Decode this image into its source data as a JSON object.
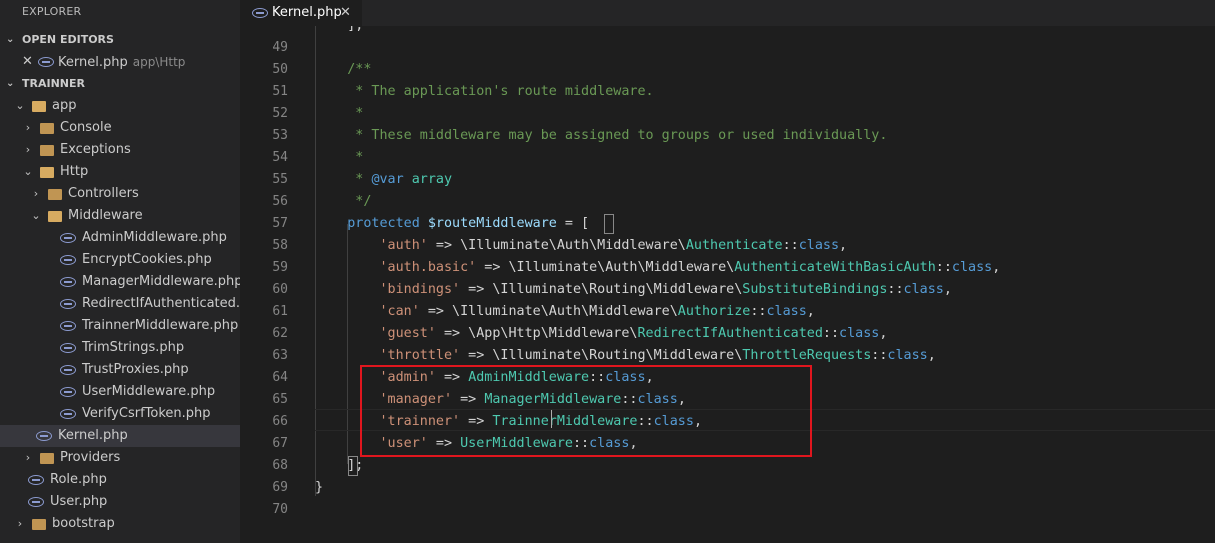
{
  "sidebar": {
    "title": "EXPLORER",
    "open_editors_label": "OPEN EDITORS",
    "open_editor": {
      "name": "Kernel.php",
      "path": "app\\Http"
    },
    "project_label": "TRAINNER",
    "tree": [
      {
        "label": "app",
        "depth": 0,
        "type": "folder-open",
        "chev": "⌄"
      },
      {
        "label": "Console",
        "depth": 1,
        "type": "folder",
        "chev": "›"
      },
      {
        "label": "Exceptions",
        "depth": 1,
        "type": "folder",
        "chev": "›"
      },
      {
        "label": "Http",
        "depth": 1,
        "type": "folder-open",
        "chev": "⌄"
      },
      {
        "label": "Controllers",
        "depth": 2,
        "type": "folder",
        "chev": "›"
      },
      {
        "label": "Middleware",
        "depth": 2,
        "type": "folder-open",
        "chev": "⌄"
      },
      {
        "label": "AdminMiddleware.php",
        "depth": 3,
        "type": "php"
      },
      {
        "label": "EncryptCookies.php",
        "depth": 3,
        "type": "php"
      },
      {
        "label": "ManagerMiddleware.php",
        "depth": 3,
        "type": "php"
      },
      {
        "label": "RedirectIfAuthenticated.p...",
        "depth": 3,
        "type": "php"
      },
      {
        "label": "TrainnerMiddleware.php",
        "depth": 3,
        "type": "php"
      },
      {
        "label": "TrimStrings.php",
        "depth": 3,
        "type": "php"
      },
      {
        "label": "TrustProxies.php",
        "depth": 3,
        "type": "php"
      },
      {
        "label": "UserMiddleware.php",
        "depth": 3,
        "type": "php"
      },
      {
        "label": "VerifyCsrfToken.php",
        "depth": 3,
        "type": "php"
      },
      {
        "label": "Kernel.php",
        "depth": 2,
        "type": "php",
        "selected": true
      },
      {
        "label": "Providers",
        "depth": 1,
        "type": "folder",
        "chev": "›"
      },
      {
        "label": "Role.php",
        "depth": 1,
        "type": "php"
      },
      {
        "label": "User.php",
        "depth": 1,
        "type": "php"
      },
      {
        "label": "bootstrap",
        "depth": 0,
        "type": "folder",
        "chev": "›"
      }
    ]
  },
  "tab": {
    "label": "Kernel.php",
    "close": "✕"
  },
  "editor": {
    "lines": [
      {
        "n": "",
        "segs": [
          [
            "pl",
            "    ];"
          ]
        ]
      },
      {
        "n": "49",
        "segs": []
      },
      {
        "n": "50",
        "segs": [
          [
            "cm",
            "    /**"
          ]
        ]
      },
      {
        "n": "51",
        "segs": [
          [
            "cm",
            "     * The application's route middleware."
          ]
        ]
      },
      {
        "n": "52",
        "segs": [
          [
            "cm",
            "     *"
          ]
        ]
      },
      {
        "n": "53",
        "segs": [
          [
            "cm",
            "     * These middleware may be assigned to groups or used individually."
          ]
        ]
      },
      {
        "n": "54",
        "segs": [
          [
            "cm",
            "     *"
          ]
        ]
      },
      {
        "n": "55",
        "segs": [
          [
            "cm",
            "     * "
          ],
          [
            "kw",
            "@var"
          ],
          [
            "cm",
            " "
          ],
          [
            "cl",
            "array"
          ]
        ]
      },
      {
        "n": "56",
        "segs": [
          [
            "cm",
            "     */"
          ]
        ]
      },
      {
        "n": "57",
        "segs": [
          [
            "kw",
            "    protected "
          ],
          [
            "vr",
            "$routeMiddleware"
          ],
          [
            "pl",
            " = ["
          ]
        ]
      },
      {
        "n": "58",
        "segs": [
          [
            "st",
            "        'auth'"
          ],
          [
            "pl",
            " => \\Illuminate\\Auth\\Middleware\\"
          ],
          [
            "cl",
            "Authenticate"
          ],
          [
            "pl",
            "::"
          ],
          [
            "kw",
            "class"
          ],
          [
            "pl",
            ","
          ]
        ]
      },
      {
        "n": "59",
        "segs": [
          [
            "st",
            "        'auth.basic'"
          ],
          [
            "pl",
            " => \\Illuminate\\Auth\\Middleware\\"
          ],
          [
            "cl",
            "AuthenticateWithBasicAuth"
          ],
          [
            "pl",
            "::"
          ],
          [
            "kw",
            "class"
          ],
          [
            "pl",
            ","
          ]
        ]
      },
      {
        "n": "60",
        "segs": [
          [
            "st",
            "        'bindings'"
          ],
          [
            "pl",
            " => \\Illuminate\\Routing\\Middleware\\"
          ],
          [
            "cl",
            "SubstituteBindings"
          ],
          [
            "pl",
            "::"
          ],
          [
            "kw",
            "class"
          ],
          [
            "pl",
            ","
          ]
        ]
      },
      {
        "n": "61",
        "segs": [
          [
            "st",
            "        'can'"
          ],
          [
            "pl",
            " => \\Illuminate\\Auth\\Middleware\\"
          ],
          [
            "cl",
            "Authorize"
          ],
          [
            "pl",
            "::"
          ],
          [
            "kw",
            "class"
          ],
          [
            "pl",
            ","
          ]
        ]
      },
      {
        "n": "62",
        "segs": [
          [
            "st",
            "        'guest'"
          ],
          [
            "pl",
            " => \\App\\Http\\Middleware\\"
          ],
          [
            "cl",
            "RedirectIfAuthenticated"
          ],
          [
            "pl",
            "::"
          ],
          [
            "kw",
            "class"
          ],
          [
            "pl",
            ","
          ]
        ]
      },
      {
        "n": "63",
        "segs": [
          [
            "st",
            "        'throttle'"
          ],
          [
            "pl",
            " => \\Illuminate\\Routing\\Middleware\\"
          ],
          [
            "cl",
            "ThrottleRequests"
          ],
          [
            "pl",
            "::"
          ],
          [
            "kw",
            "class"
          ],
          [
            "pl",
            ","
          ]
        ]
      },
      {
        "n": "64",
        "segs": [
          [
            "st",
            "        'admin'"
          ],
          [
            "pl",
            " => "
          ],
          [
            "cl",
            "AdminMiddleware"
          ],
          [
            "pl",
            "::"
          ],
          [
            "kw",
            "class"
          ],
          [
            "pl",
            ","
          ]
        ]
      },
      {
        "n": "65",
        "segs": [
          [
            "st",
            "        'manager'"
          ],
          [
            "pl",
            " => "
          ],
          [
            "cl",
            "ManagerMiddleware"
          ],
          [
            "pl",
            "::"
          ],
          [
            "kw",
            "class"
          ],
          [
            "pl",
            ","
          ]
        ]
      },
      {
        "n": "66",
        "segs": [
          [
            "st",
            "        'trainner'"
          ],
          [
            "pl",
            " => "
          ],
          [
            "cl",
            "TrainnerMiddleware"
          ],
          [
            "pl",
            "::"
          ],
          [
            "kw",
            "class"
          ],
          [
            "pl",
            ","
          ]
        ]
      },
      {
        "n": "67",
        "segs": [
          [
            "st",
            "        'user'"
          ],
          [
            "pl",
            " => "
          ],
          [
            "cl",
            "UserMiddleware"
          ],
          [
            "pl",
            "::"
          ],
          [
            "kw",
            "class"
          ],
          [
            "pl",
            ","
          ]
        ]
      },
      {
        "n": "68",
        "segs": [
          [
            "pl",
            "    ];"
          ]
        ]
      },
      {
        "n": "69",
        "segs": [
          [
            "pl",
            "}"
          ]
        ]
      },
      {
        "n": "70",
        "segs": []
      }
    ]
  },
  "colors": {
    "highlight_box": "#e0161e",
    "accent_php": "#8c9bd0",
    "folder": "#c09553"
  }
}
